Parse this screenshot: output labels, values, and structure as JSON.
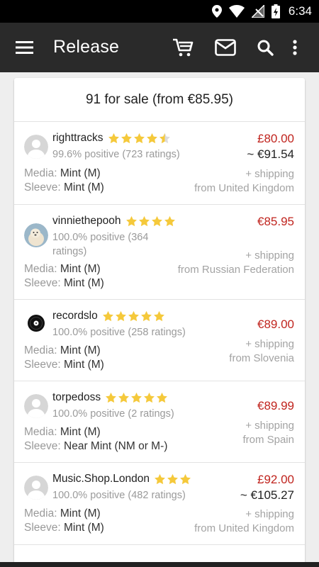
{
  "status_bar": {
    "time": "6:34"
  },
  "app_bar": {
    "title": "Release"
  },
  "summary": {
    "text": "91 for sale (from €85.95)"
  },
  "colors": {
    "price": "#c0241e",
    "star": "#f5c93b",
    "app_bar": "#2a2a2a"
  },
  "listings": [
    {
      "seller": "righttracks",
      "rating": 4.5,
      "rating_text": "99.6% positive (723 ratings)",
      "price": "£80.00",
      "converted": "~ €91.54",
      "media_label": "Media:",
      "media": "Mint (M)",
      "sleeve_label": "Sleeve:",
      "sleeve": "Mint (M)",
      "shipping": "+ shipping",
      "from": "from United Kingdom",
      "avatar": "default-avatar"
    },
    {
      "seller": "vinniethepooh",
      "rating": 4,
      "rating_text_1": "100.0% positive (364",
      "rating_text_2": "ratings)",
      "price": "€85.95",
      "media_label": "Media:",
      "media": "Mint (M)",
      "sleeve_label": "Sleeve:",
      "sleeve": "Mint (M)",
      "shipping": "+ shipping",
      "from": "from Russian Federation",
      "avatar": "dog-photo-avatar"
    },
    {
      "seller": "recordslo",
      "rating": 5,
      "rating_text": "100.0% positive (258 ratings)",
      "price": "€89.00",
      "media_label": "Media:",
      "media": "Mint (M)",
      "sleeve_label": "Sleeve:",
      "sleeve": "Mint (M)",
      "shipping": "+ shipping",
      "from": "from Slovenia",
      "avatar": "vinyl-logo-avatar"
    },
    {
      "seller": "torpedoss",
      "rating": 5,
      "rating_text": "100.0% positive (2 ratings)",
      "price": "€89.99",
      "media_label": "Media:",
      "media": "Mint (M)",
      "sleeve_label": "Sleeve:",
      "sleeve": "Near Mint (NM or M-)",
      "shipping": "+ shipping",
      "from": "from Spain",
      "avatar": "default-avatar"
    },
    {
      "seller": "Music.Shop.London",
      "rating": 3,
      "rating_text": "100.0% positive (482 ratings)",
      "price": "£92.00",
      "converted": "~ €105.27",
      "media_label": "Media:",
      "media": "Mint (M)",
      "sleeve_label": "Sleeve:",
      "sleeve": "Mint (M)",
      "shipping": "+ shipping",
      "from": "from United Kingdom",
      "avatar": "default-avatar"
    }
  ]
}
